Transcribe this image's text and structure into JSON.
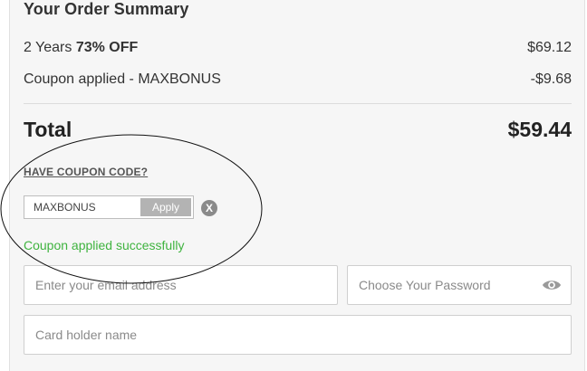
{
  "summary": {
    "title": "Your Order Summary",
    "plan_prefix": "2 Years ",
    "plan_discount": "73% OFF",
    "plan_amount": "$69.12",
    "coupon_line_label": "Coupon applied - MAXBONUS",
    "coupon_line_amount": "-$9.68",
    "total_label": "Total",
    "total_amount": "$59.44"
  },
  "coupon": {
    "link_label": "HAVE COUPON CODE?",
    "code_value": "MAXBONUS",
    "apply_label": "Apply",
    "clear_glyph": "X",
    "success_message": "Coupon applied successfully"
  },
  "form": {
    "email_placeholder": "Enter your email address",
    "password_placeholder": "Choose Your Password",
    "cardholder_placeholder": "Card holder name"
  },
  "icons": {
    "clear": "close-circle-icon",
    "password_toggle": "eye-icon"
  },
  "colors": {
    "success": "#3fb33f",
    "apply_button": "#b3b3b3",
    "panel_background": "#f6f6f6"
  }
}
